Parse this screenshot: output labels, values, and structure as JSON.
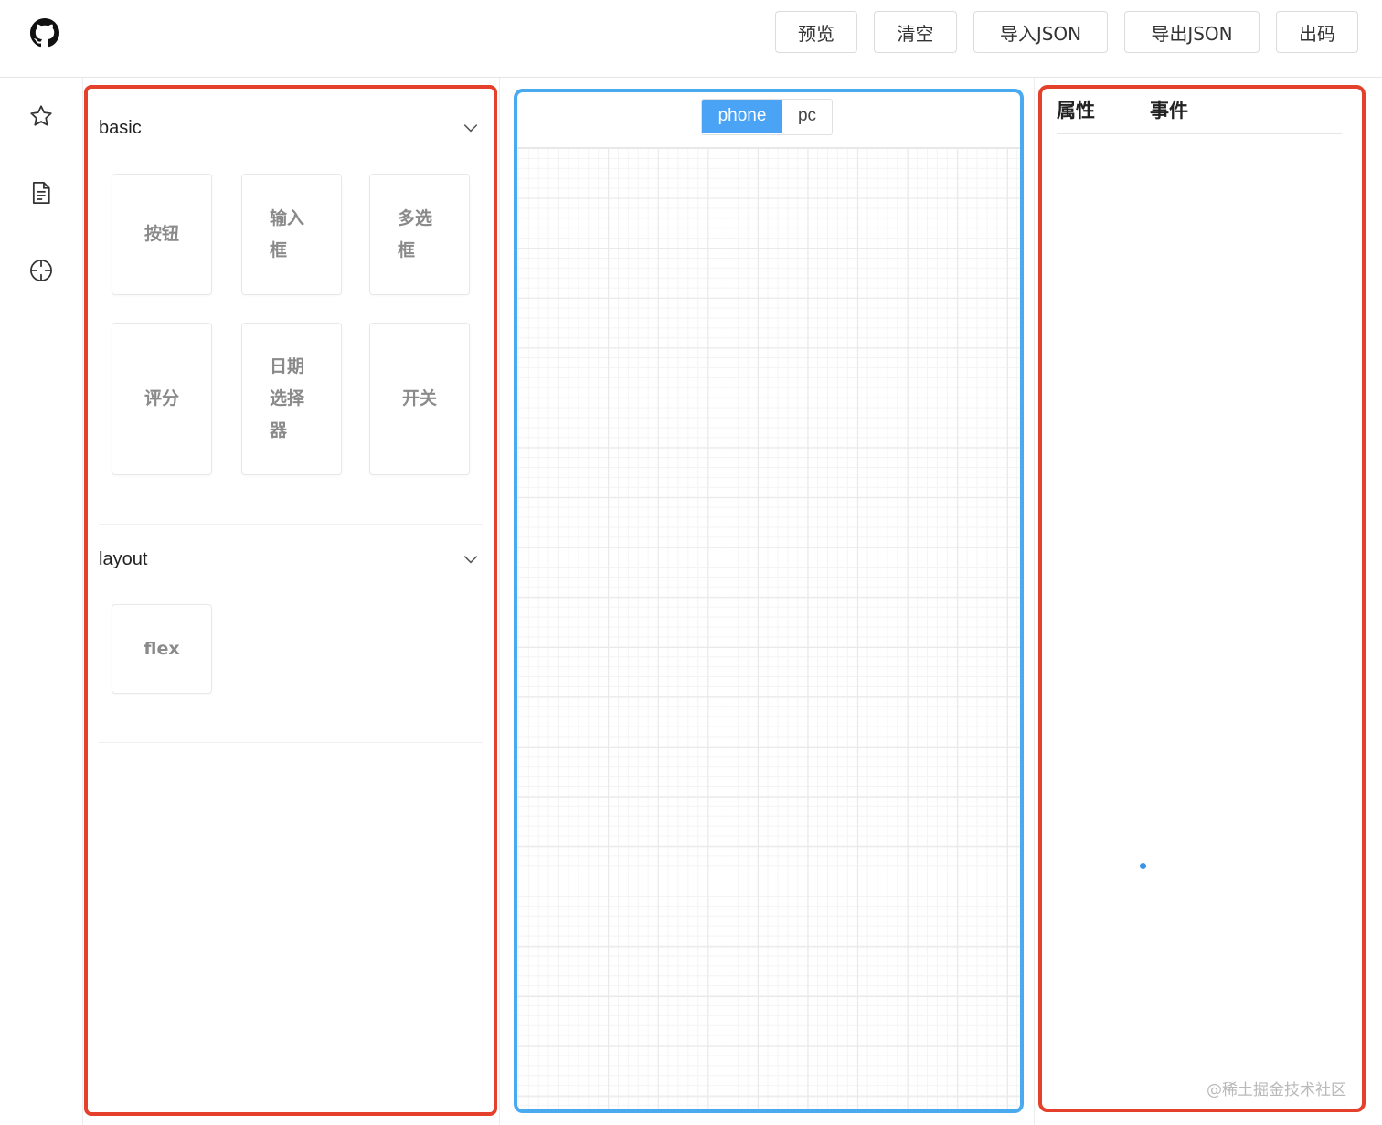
{
  "header": {
    "logo_icon": "github-icon",
    "buttons": {
      "preview": "预览",
      "clear": "清空",
      "import_json": "导入JSON",
      "export_json": "导出JSON",
      "code": "出码"
    }
  },
  "rail": {
    "icons": [
      "star-icon",
      "document-icon",
      "crosshair-icon"
    ]
  },
  "palette": {
    "groups": [
      {
        "title": "basic",
        "items": [
          "按钮",
          "输入框",
          "多选框",
          "评分",
          "日期选择器",
          "开关"
        ]
      },
      {
        "title": "layout",
        "items": [
          "flex"
        ]
      }
    ]
  },
  "canvas": {
    "device_options": [
      "phone",
      "pc"
    ],
    "active_device": "phone"
  },
  "props": {
    "tabs": [
      "属性",
      "事件"
    ]
  },
  "watermark": "@稀土掘金技术社区",
  "colors": {
    "palette_border": "#e4402c",
    "canvas_border": "#4aaaf0",
    "active_accent": "#4aa3f5"
  }
}
